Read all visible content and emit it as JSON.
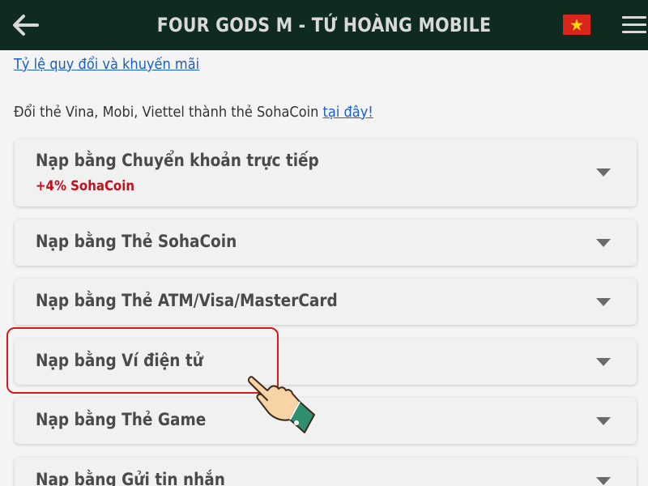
{
  "header": {
    "title": "FOUR GODS M - TỨ HOÀNG MOBILE",
    "back_icon": "arrow-left-icon",
    "flag_icon": "vietnam-flag-icon",
    "menu_icon": "hamburger-menu-icon",
    "background_color": "#0f2a1f"
  },
  "content": {
    "exchange_link": "Tỷ lệ quy đổi và khuyến mãi",
    "convert_text": "Đổi thẻ Vina, Mobi, Viettel thành thẻ SohaCoin ",
    "convert_link": "tại đây!"
  },
  "payment_methods": [
    {
      "label": "Nạp bằng Chuyển khoản trực tiếp",
      "bonus": "+4% SohaCoin"
    },
    {
      "label": "Nạp bằng Thẻ SohaCoin"
    },
    {
      "label": "Nạp bằng Thẻ ATM/Visa/MasterCard"
    },
    {
      "label": "Nạp bằng Ví điện tử",
      "highlighted": true
    },
    {
      "label": "Nạp bằng Thẻ Game"
    },
    {
      "label": "Nạp bằng Gửi tin nhắn"
    }
  ],
  "colors": {
    "link": "#1a5fc4",
    "bonus": "#c0101c",
    "highlight_border": "#d4181e"
  },
  "pointer_icon": "pointing-hand-icon"
}
